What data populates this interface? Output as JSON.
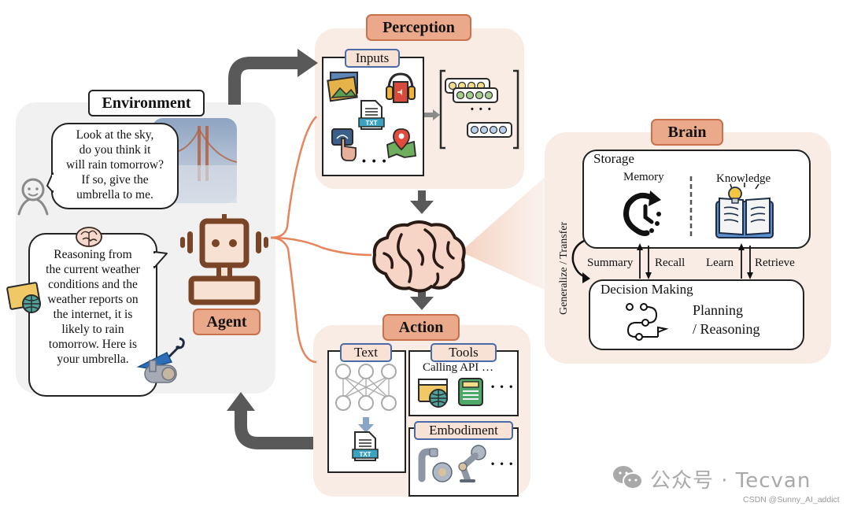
{
  "environment": {
    "title": "Environment",
    "human_bubble_lines": [
      "Look at the sky,",
      "do you think it",
      "will rain tomorrow?",
      "If so, give the",
      "umbrella to me."
    ],
    "agent_bubble_lines": [
      "Reasoning from",
      "the current weather",
      "conditions and the",
      "weather reports on",
      "the internet, it is",
      "likely to rain",
      "tomorrow. Here is",
      "your umbrella."
    ],
    "icons": [
      "person-icon",
      "bridge-fog-photo",
      "brain-icon",
      "browser-globe-icon",
      "umbrella-icon",
      "robot-arm-icon"
    ]
  },
  "agent": {
    "label": "Agent",
    "icon": "robot-icon"
  },
  "perception": {
    "title": "Perception",
    "inputs_label": "Inputs",
    "input_icons": [
      "image-icon",
      "audio-book-icon",
      "txt-file-icon",
      "touch-icon",
      "map-pin-icon"
    ],
    "more": "• • •",
    "embedding_more": "• • •"
  },
  "brain": {
    "title": "Brain",
    "storage_label": "Storage",
    "memory_label": "Memory",
    "knowledge_label": "Knowledge",
    "decision_label": "Decision Making",
    "planning_line1": "Planning",
    "planning_line2": "/ Reasoning",
    "arrows": {
      "summary": "Summary",
      "recall": "Recall",
      "learn": "Learn",
      "retrieve": "Retrieve",
      "generalize": "Generalize / Transfer"
    }
  },
  "action": {
    "title": "Action",
    "text_label": "Text",
    "tools_label": "Tools",
    "tools_caption": "Calling API …",
    "embodiment_label": "Embodiment",
    "more": "• • •"
  },
  "colors": {
    "tag_fill": "#eba98c",
    "tag_border": "#c8714c",
    "panel_fill": "#f8ece5",
    "env_fill": "#f1f1f1",
    "robot_brown": "#7a4527",
    "flow_arrow": "#595959",
    "connector": "#e8845c"
  },
  "watermark": {
    "text": "公众号 · Tecvan",
    "credit": "CSDN @Sunny_AI_addict"
  }
}
